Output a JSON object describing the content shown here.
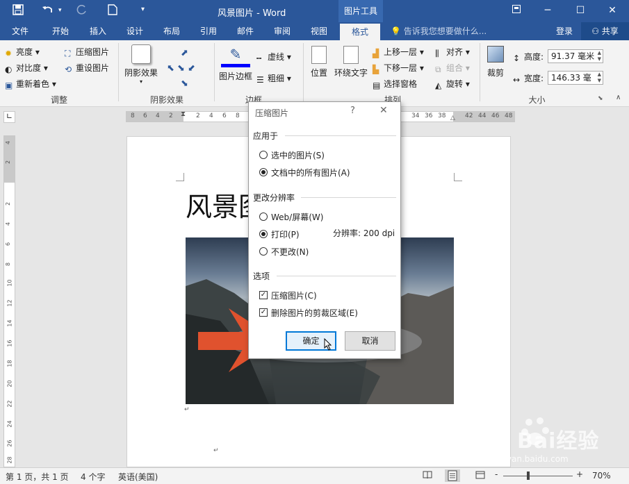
{
  "window": {
    "title": "风景图片 - Word",
    "context_tab_title": "图片工具",
    "quick_access": [
      "save-icon",
      "undo-icon",
      "redo-icon",
      "new-document-icon",
      "customize-icon"
    ],
    "window_buttons": [
      "restore-ribbon-icon",
      "minimize-icon",
      "maximize-icon",
      "close-icon"
    ]
  },
  "tabs": [
    {
      "label": "文件"
    },
    {
      "label": "开始"
    },
    {
      "label": "插入"
    },
    {
      "label": "设计"
    },
    {
      "label": "布局"
    },
    {
      "label": "引用"
    },
    {
      "label": "邮件"
    },
    {
      "label": "审阅"
    },
    {
      "label": "视图"
    },
    {
      "label": "格式"
    }
  ],
  "tell_me": "告诉我您想要做什么...",
  "login": "登录",
  "share": "共享",
  "ribbon": {
    "adjust": {
      "brightness": "亮度",
      "contrast": "对比度",
      "recolor": "重新着色",
      "compress": "压缩图片",
      "reset": "重设图片",
      "label": "调整"
    },
    "shadow": {
      "effect": "阴影效果",
      "label": "阴影效果"
    },
    "border": {
      "picture_border": "图片边框",
      "dashes": "虚线",
      "weight": "粗细",
      "label": "边框"
    },
    "arrange": {
      "position": "位置",
      "wrap_text": "环绕文字",
      "bring_forward": "上移一层",
      "send_backward": "下移一层",
      "selection_pane": "选择窗格",
      "align": "对齐",
      "group": "组合",
      "rotate": "旋转",
      "label": "排列"
    },
    "size": {
      "crop": "裁剪",
      "height_label": "高度:",
      "height_value": "91.37 毫米",
      "width_label": "宽度:",
      "width_value": "146.33 毫",
      "label": "大小"
    }
  },
  "ruler": {
    "h_left": [
      "8",
      "6",
      "4",
      "2"
    ],
    "h_right_a": [
      "2",
      "4",
      "6",
      "8"
    ],
    "h_right_b": [
      "34",
      "36",
      "38"
    ],
    "h_right_c": [
      "42",
      "44",
      "46",
      "48"
    ],
    "v": [
      "4",
      "2",
      "2",
      "4",
      "6",
      "8",
      "10",
      "12",
      "14",
      "16",
      "18",
      "20",
      "22",
      "24",
      "26",
      "28"
    ]
  },
  "document": {
    "title": "风景图",
    "paragraph_mark": "↵"
  },
  "dialog": {
    "title": "压缩图片",
    "help": "?",
    "apply_to": {
      "label": "应用于",
      "options": [
        {
          "label": "选中的图片(S)",
          "selected": false
        },
        {
          "label": "文档中的所有图片(A)",
          "selected": true
        }
      ]
    },
    "resolution": {
      "label": "更改分辨率",
      "options": [
        {
          "label": "Web/屏幕(W)",
          "selected": false
        },
        {
          "label": "打印(P)",
          "selected": true
        },
        {
          "label": "不更改(N)",
          "selected": false
        }
      ],
      "dpi_text": "分辨率:  200 dpi"
    },
    "options": {
      "label": "选项",
      "checkboxes": [
        {
          "label": "压缩图片(C)",
          "checked": true
        },
        {
          "label": "删除图片的剪裁区域(E)",
          "checked": true
        }
      ]
    },
    "ok": "确定",
    "cancel": "取消"
  },
  "statusbar": {
    "page": "第 1 页，共 1 页",
    "words": "4 个字",
    "language": "英语(美国)",
    "zoom": "70%",
    "minus": "-",
    "plus": "+"
  },
  "watermark": {
    "brand": "Bai经验",
    "url": "jingyan.baidu.com"
  },
  "colors": {
    "accent": "#2b579a",
    "arrow": "#e0522e",
    "primary_button_border": "#0078d7"
  }
}
